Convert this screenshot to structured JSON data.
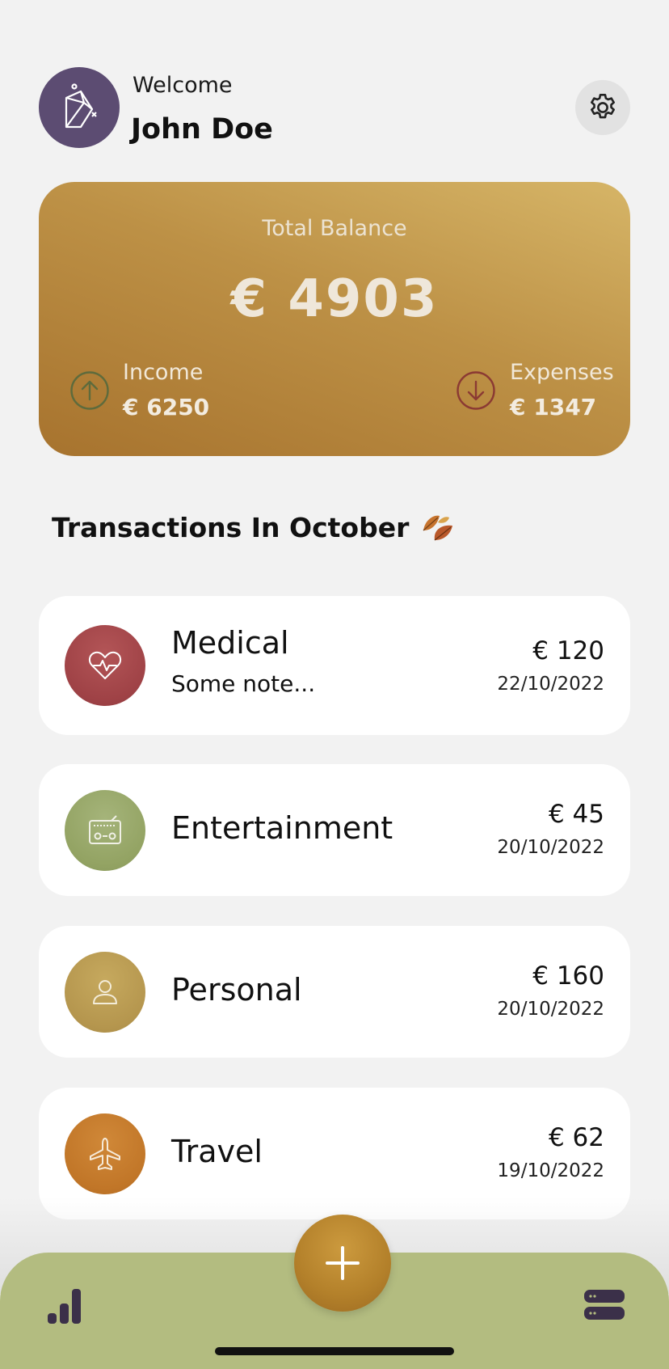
{
  "header": {
    "welcome": "Welcome",
    "username": "John Doe"
  },
  "balance": {
    "total_label": "Total Balance",
    "total_value": "€ 4903",
    "income_label": "Income",
    "income_value": "€ 6250",
    "expenses_label": "Expenses",
    "expenses_value": "€ 1347"
  },
  "transactions_title": "Transactions In October",
  "transactions": [
    {
      "name": "Medical",
      "note": "Some note...",
      "amount": "€ 120",
      "date": "22/10/2022",
      "icon": "heartbeat-icon",
      "color": "#a3474a"
    },
    {
      "name": "Entertainment",
      "amount": "€ 45",
      "date": "20/10/2022",
      "icon": "radio-icon",
      "color": "#95a565"
    },
    {
      "name": "Personal",
      "amount": "€ 160",
      "date": "20/10/2022",
      "icon": "person-icon",
      "color": "#b99a50"
    },
    {
      "name": "Travel",
      "amount": "€ 62",
      "date": "19/10/2022",
      "icon": "airplane-icon",
      "color": "#c37a2a"
    }
  ],
  "colors": {
    "background": "#f2f2f2",
    "card_gold": "#bd9146",
    "bottom_bar": "#b3bc80",
    "avatar": "#5c4c72",
    "income_icon": "#5e6b3c",
    "expense_icon": "#8b3a33"
  }
}
